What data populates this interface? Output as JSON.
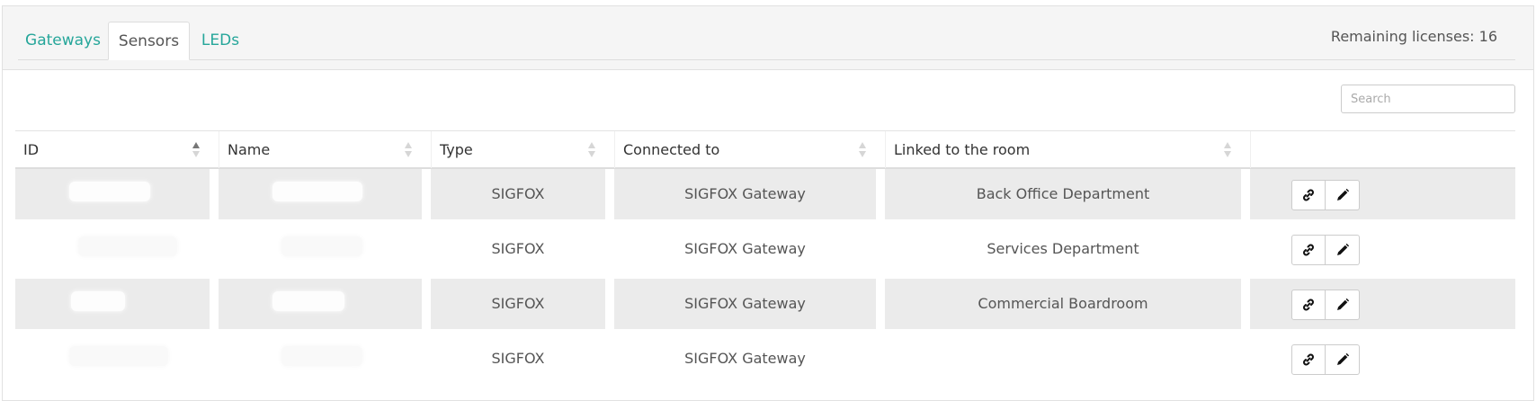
{
  "tabs": [
    {
      "label": "Gateways",
      "active": false
    },
    {
      "label": "Sensors",
      "active": true
    },
    {
      "label": "LEDs",
      "active": false
    }
  ],
  "licenses": "Remaining licenses: 16",
  "search": {
    "placeholder": "Search",
    "value": ""
  },
  "table": {
    "columns": [
      "ID",
      "Name",
      "Type",
      "Connected to",
      "Linked to the room",
      ""
    ],
    "sorted_column": "ID",
    "rows": [
      {
        "id": "",
        "name": "",
        "type": "SIGFOX",
        "connected_to": "SIGFOX Gateway",
        "room": "Back Office Department"
      },
      {
        "id": "",
        "name": "",
        "type": "SIGFOX",
        "connected_to": "SIGFOX Gateway",
        "room": "Services Department"
      },
      {
        "id": "",
        "name": "",
        "type": "SIGFOX",
        "connected_to": "SIGFOX Gateway",
        "room": "Commercial Boardroom"
      },
      {
        "id": "",
        "name": "",
        "type": "SIGFOX",
        "connected_to": "SIGFOX Gateway",
        "room": ""
      }
    ]
  },
  "icons": {
    "link": "link-icon",
    "edit": "pencil-icon"
  },
  "colors": {
    "accent": "#26a69a",
    "row_stripe": "#ebebeb",
    "header_bg": "#f5f5f5"
  }
}
